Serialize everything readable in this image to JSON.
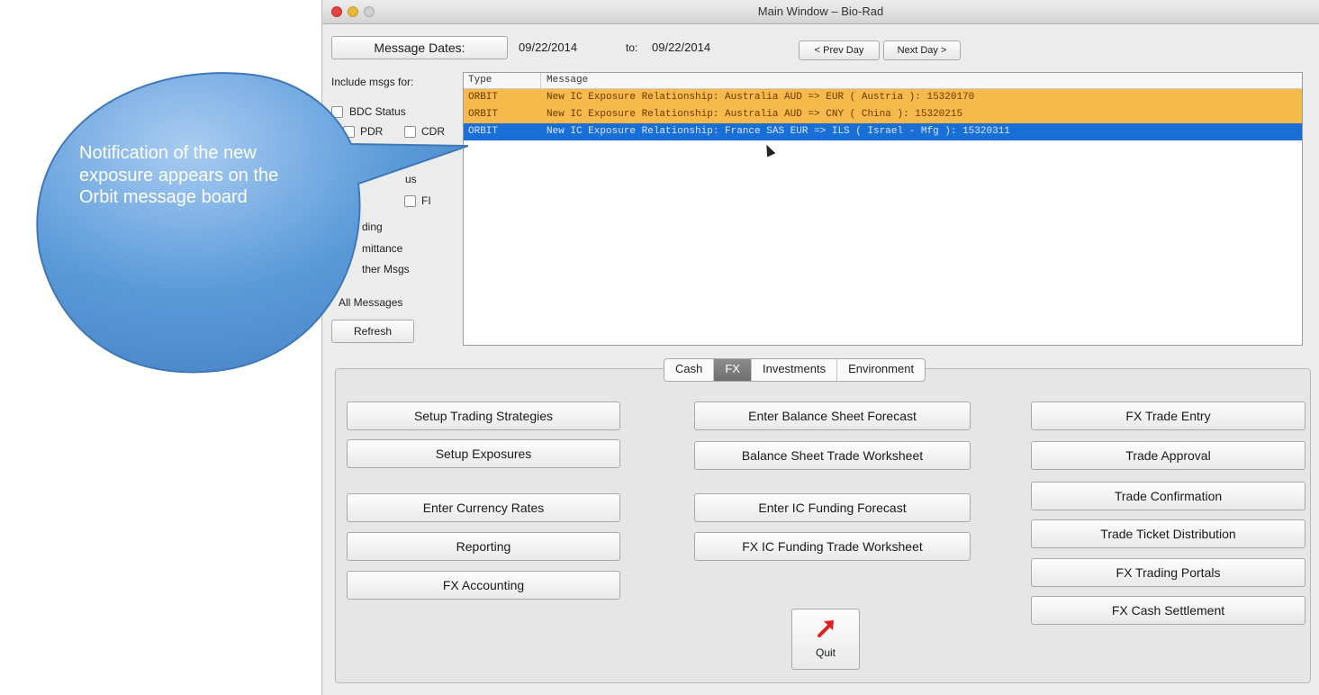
{
  "window": {
    "title": "Main Window – Bio-Rad"
  },
  "dates": {
    "button_label": "Message Dates:",
    "from": "09/22/2014",
    "to_label": "to:",
    "to": "09/22/2014",
    "prev_day": "< Prev Day",
    "next_day": "Next Day >"
  },
  "filters": {
    "heading": "Include msgs for:",
    "bdc_status": "BDC Status",
    "pdr": "PDR",
    "cdr": "CDR",
    "partial_status": "us",
    "fi": "FI",
    "funding": "ding",
    "remittance": "mittance",
    "other_msgs": "ther Msgs",
    "all_messages": "All Messages",
    "refresh": "Refresh"
  },
  "messages": {
    "col_type": "Type",
    "col_message": "Message",
    "rows": [
      {
        "type": "ORBIT",
        "message": "New IC Exposure Relationship: Australia AUD => EUR ( Austria ): 15320170",
        "state": "highlight"
      },
      {
        "type": "ORBIT",
        "message": "New IC Exposure Relationship: Australia AUD => CNY ( China ): 15320215",
        "state": "highlight"
      },
      {
        "type": "ORBIT",
        "message": "New IC Exposure Relationship: France SAS EUR => ILS ( Israel - Mfg ): 15320311",
        "state": "selected"
      }
    ]
  },
  "tabs": [
    "Cash",
    "FX",
    "Investments",
    "Environment"
  ],
  "active_tab": "FX",
  "buttons": {
    "setup_trading_strategies": "Setup Trading Strategies",
    "setup_exposures": "Setup Exposures",
    "enter_currency_rates": "Enter Currency Rates",
    "reporting": "Reporting",
    "fx_accounting": "FX Accounting",
    "enter_balance_sheet_forecast": "Enter Balance Sheet Forecast",
    "balance_sheet_trade_worksheet": "Balance Sheet Trade Worksheet",
    "enter_ic_funding_forecast": "Enter IC Funding Forecast",
    "fx_ic_funding_trade_worksheet": "FX IC Funding Trade Worksheet",
    "fx_trade_entry": "FX Trade Entry",
    "trade_approval": "Trade Approval",
    "trade_confirmation": "Trade Confirmation",
    "trade_ticket_distribution": "Trade Ticket Distribution",
    "fx_trading_portals": "FX Trading Portals",
    "fx_cash_settlement": "FX Cash Settlement",
    "quit": "Quit"
  },
  "callout": {
    "text": "Notification of the new exposure appears on the Orbit message board"
  },
  "colors": {
    "highlight_row": "#f6b94c",
    "selected_row": "#1a6fd6",
    "callout_fill": "#5b9ad9",
    "quit_arrow": "#e02020"
  }
}
